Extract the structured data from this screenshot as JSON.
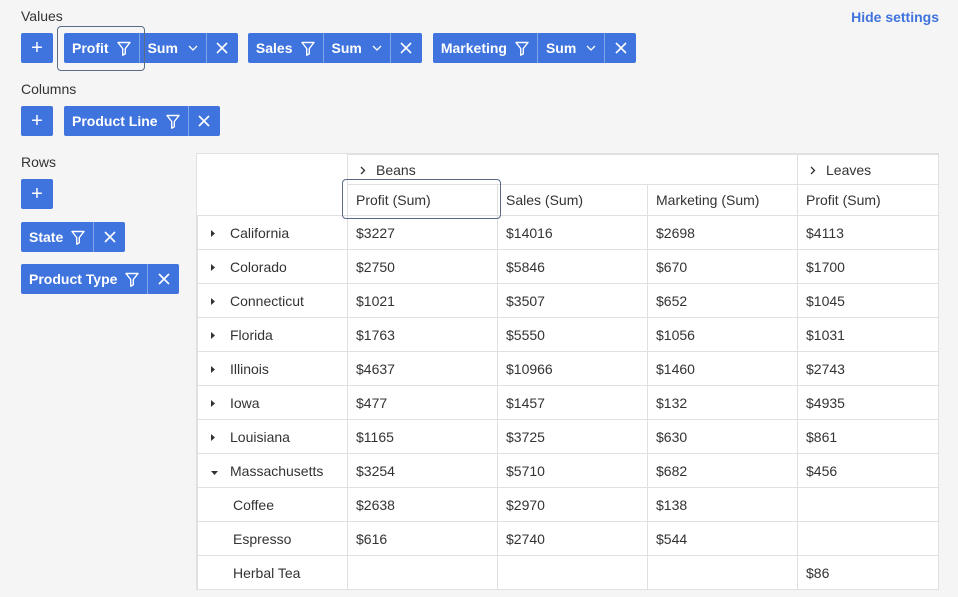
{
  "settings": {
    "values_title": "Values",
    "columns_title": "Columns",
    "rows_title": "Rows",
    "hide_label": "Hide settings",
    "add_label": "+",
    "values": [
      {
        "name": "Profit",
        "agg": "Sum"
      },
      {
        "name": "Sales",
        "agg": "Sum"
      },
      {
        "name": "Marketing",
        "agg": "Sum"
      }
    ],
    "columns": [
      {
        "name": "Product Line"
      }
    ],
    "rows": [
      {
        "name": "State"
      },
      {
        "name": "Product Type"
      }
    ]
  },
  "grid": {
    "col_groups": [
      "Beans",
      "Leaves"
    ],
    "col_headers": [
      "Profit (Sum)",
      "Sales (Sum)",
      "Marketing (Sum)",
      "Profit (Sum)"
    ],
    "rows": [
      {
        "label": "California",
        "state": "collapsed",
        "cells": [
          "$3227",
          "$14016",
          "$2698",
          "$4113"
        ]
      },
      {
        "label": "Colorado",
        "state": "collapsed",
        "cells": [
          "$2750",
          "$5846",
          "$670",
          "$1700"
        ]
      },
      {
        "label": "Connecticut",
        "state": "collapsed",
        "cells": [
          "$1021",
          "$3507",
          "$652",
          "$1045"
        ]
      },
      {
        "label": "Florida",
        "state": "collapsed",
        "cells": [
          "$1763",
          "$5550",
          "$1056",
          "$1031"
        ]
      },
      {
        "label": "Illinois",
        "state": "collapsed",
        "cells": [
          "$4637",
          "$10966",
          "$1460",
          "$2743"
        ]
      },
      {
        "label": "Iowa",
        "state": "collapsed",
        "cells": [
          "$477",
          "$1457",
          "$132",
          "$4935"
        ]
      },
      {
        "label": "Louisiana",
        "state": "collapsed",
        "cells": [
          "$1165",
          "$3725",
          "$630",
          "$861"
        ]
      },
      {
        "label": "Massachusetts",
        "state": "expanded",
        "cells": [
          "$3254",
          "$5710",
          "$682",
          "$456"
        ]
      },
      {
        "label": "Coffee",
        "state": "child",
        "cells": [
          "$2638",
          "$2970",
          "$138",
          ""
        ]
      },
      {
        "label": "Espresso",
        "state": "child",
        "cells": [
          "$616",
          "$2740",
          "$544",
          ""
        ]
      },
      {
        "label": "Herbal Tea",
        "state": "child",
        "cells": [
          "",
          "",
          "",
          "$86"
        ]
      }
    ]
  },
  "colors": {
    "accent": "#3f73dd",
    "grid_border": "#e0e0e0",
    "background": "#f5f5f5"
  }
}
